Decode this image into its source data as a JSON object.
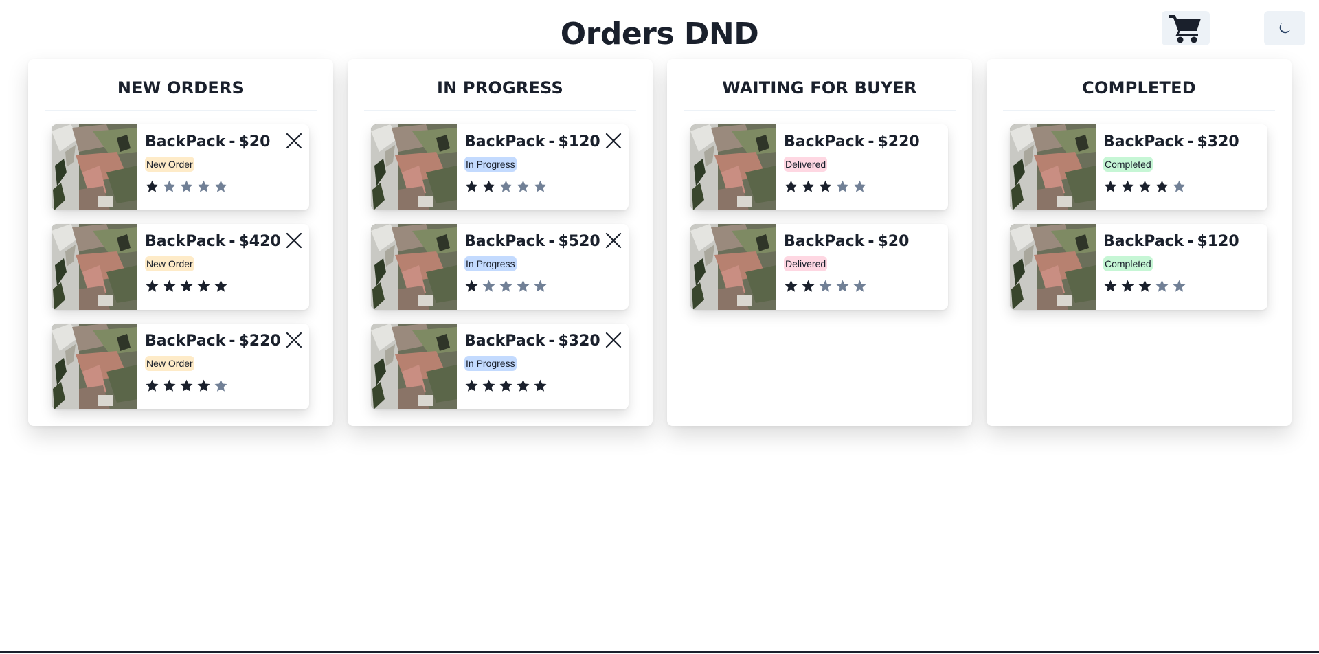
{
  "header": {
    "title": "Orders DND"
  },
  "colors": {
    "star_filled": "#1a202c",
    "star_empty": "#718096",
    "badge_new": "#feebc8",
    "badge_progress": "#c3dafe",
    "badge_delivered": "#fed7e2",
    "badge_completed": "#c6f6d5"
  },
  "icons": {
    "cart": "shopping-cart-icon",
    "theme": "moon-icon",
    "close": "close-icon",
    "star": "star-icon"
  },
  "columns": [
    {
      "title": "NEW ORDERS",
      "cards": [
        {
          "name": "BackPack",
          "separator": "-",
          "price": "$20",
          "status": "New Order",
          "rating": 1,
          "max_rating": 5,
          "removable": true
        },
        {
          "name": "BackPack",
          "separator": "-",
          "price": "$420",
          "status": "New Order",
          "rating": 5,
          "max_rating": 5,
          "removable": true
        },
        {
          "name": "BackPack",
          "separator": "-",
          "price": "$220",
          "status": "New Order",
          "rating": 4,
          "max_rating": 5,
          "removable": true
        }
      ]
    },
    {
      "title": "IN PROGRESS",
      "cards": [
        {
          "name": "BackPack",
          "separator": "-",
          "price": "$120",
          "status": "In Progress",
          "rating": 2,
          "max_rating": 5,
          "removable": true
        },
        {
          "name": "BackPack",
          "separator": "-",
          "price": "$520",
          "status": "In Progress",
          "rating": 1,
          "max_rating": 5,
          "removable": true
        },
        {
          "name": "BackPack",
          "separator": "-",
          "price": "$320",
          "status": "In Progress",
          "rating": 5,
          "max_rating": 5,
          "removable": true
        }
      ]
    },
    {
      "title": "WAITING FOR BUYER",
      "cards": [
        {
          "name": "BackPack",
          "separator": "-",
          "price": "$220",
          "status": "Delivered",
          "rating": 3,
          "max_rating": 5,
          "removable": false
        },
        {
          "name": "BackPack",
          "separator": "-",
          "price": "$20",
          "status": "Delivered",
          "rating": 2,
          "max_rating": 5,
          "removable": false
        }
      ]
    },
    {
      "title": "COMPLETED",
      "cards": [
        {
          "name": "BackPack",
          "separator": "-",
          "price": "$320",
          "status": "Completed",
          "rating": 4,
          "max_rating": 5,
          "removable": false
        },
        {
          "name": "BackPack",
          "separator": "-",
          "price": "$120",
          "status": "Completed",
          "rating": 3,
          "max_rating": 5,
          "removable": false
        }
      ]
    }
  ]
}
